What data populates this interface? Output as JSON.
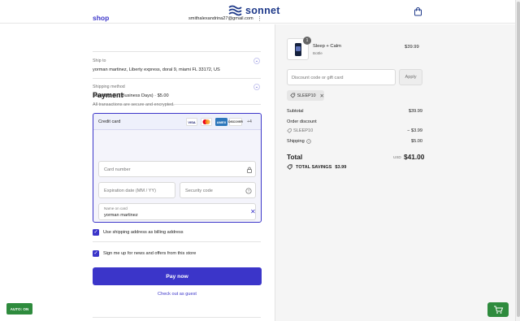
{
  "header": {
    "brand": "sonnet"
  },
  "checkout": {
    "shop_logo": "shop",
    "account_email": "smithalexandrina27@gmail.com",
    "ship_to_label": "Ship to",
    "ship_to_value": "yorman martinez, Liberty express, doral 9, miami FL 33172, US",
    "shipping_method_label": "Shipping method",
    "shipping_method_value": "Standard (5-7 Business Days) · $5.00"
  },
  "payment": {
    "title": "Payment",
    "subtitle": "All transactions are secure and encrypted.",
    "method_label": "Credit card",
    "brands": [
      "VISA",
      "",
      "AMEX",
      "DISCOVER"
    ],
    "more_brands": "+4",
    "card_number_placeholder": "Card number",
    "expiration_placeholder": "Expiration date (MM / YY)",
    "security_placeholder": "Security code",
    "name_label": "Name on card",
    "name_value": "yorman martinez",
    "billing_checkbox_label": "Use shipping address as billing address",
    "billing_checked": true,
    "newsletter_label": "Sign me up for news and offers from this store",
    "newsletter_checked": true,
    "pay_button": "Pay now",
    "guest_link": "Check out as guest"
  },
  "summary": {
    "item": {
      "name": "Sleep + Calm",
      "variant": "Bottle",
      "price": "$39.99",
      "quantity": "1"
    },
    "discount_placeholder": "Discount code or gift card",
    "apply_button": "Apply",
    "applied_code": "SLEEP10",
    "subtotal_label": "Subtotal",
    "subtotal_value": "$39.99",
    "order_discount_label": "Order discount",
    "discount_code": "SLEEP10",
    "discount_value": "− $3.99",
    "shipping_label": "Shipping",
    "shipping_value": "$5.00",
    "total_label": "Total",
    "total_currency": "USD",
    "total_value": "$41.00",
    "savings_label": "TOTAL SAVINGS",
    "savings_value": "$3.99"
  },
  "floating": {
    "auto_label": "AUTO: ON"
  },
  "colors": {
    "accent": "#3b35c9",
    "brand_navy": "#1f3a8a",
    "green": "#2e8b3d"
  }
}
